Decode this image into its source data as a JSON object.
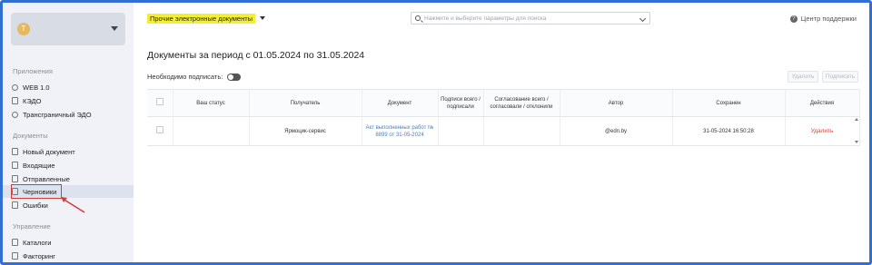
{
  "account": {
    "avatar_letter": "Т"
  },
  "sidebar": {
    "sections": [
      {
        "title": "Приложения"
      },
      {
        "title": "Документы"
      },
      {
        "title": "Управление"
      }
    ],
    "apps": [
      {
        "label": "WEB 1.0",
        "icon": "refresh-icon"
      },
      {
        "label": "КЭДО",
        "icon": "document-icon"
      },
      {
        "label": "Трансграничный ЭДО",
        "icon": "globe-icon"
      }
    ],
    "docs": [
      {
        "label": "Новый документ",
        "icon": "document-icon"
      },
      {
        "label": "Входящие",
        "icon": "document-icon"
      },
      {
        "label": "Отправленные",
        "icon": "send-icon"
      },
      {
        "label": "Черновики",
        "icon": "document-icon",
        "active": true
      },
      {
        "label": "Ошибки",
        "icon": "document-icon"
      }
    ],
    "mgmt": [
      {
        "label": "Каталоги",
        "icon": "document-icon"
      },
      {
        "label": "Факторинг",
        "icon": "document-icon"
      }
    ]
  },
  "topbar": {
    "doc_type": "Прочие электронные документы",
    "search_placeholder": "Нажмите и выберите параметры для поиска",
    "support": "Центр поддержки"
  },
  "main": {
    "title": "Документы за период с 01.05.2024 по 31.05.2024",
    "must_sign_label": "Необходимо подписать:",
    "delete_btn": "Удалить",
    "sign_btn": "Подписать"
  },
  "table": {
    "headers": [
      "",
      "Ваш статус",
      "Получатель",
      "Документ",
      "Подписи всего / подписали",
      "Согласование всего / согласовали / отклонили",
      "Автор",
      "Сохранен",
      "Действия"
    ],
    "rows": [
      {
        "status": "",
        "recipient": "Ярмоцик-сервис",
        "document": "Акт выполненных работ № 8899 от 31-05-2024",
        "signatures": "",
        "approvals": "",
        "author": "@edn.by",
        "saved": "31-05-2024 16:50:28",
        "action": "Удалить"
      }
    ]
  },
  "colors": {
    "accent": "#2f6fd6",
    "highlight": "#f3ee33",
    "danger": "#d94141",
    "link": "#4a7fc1"
  }
}
